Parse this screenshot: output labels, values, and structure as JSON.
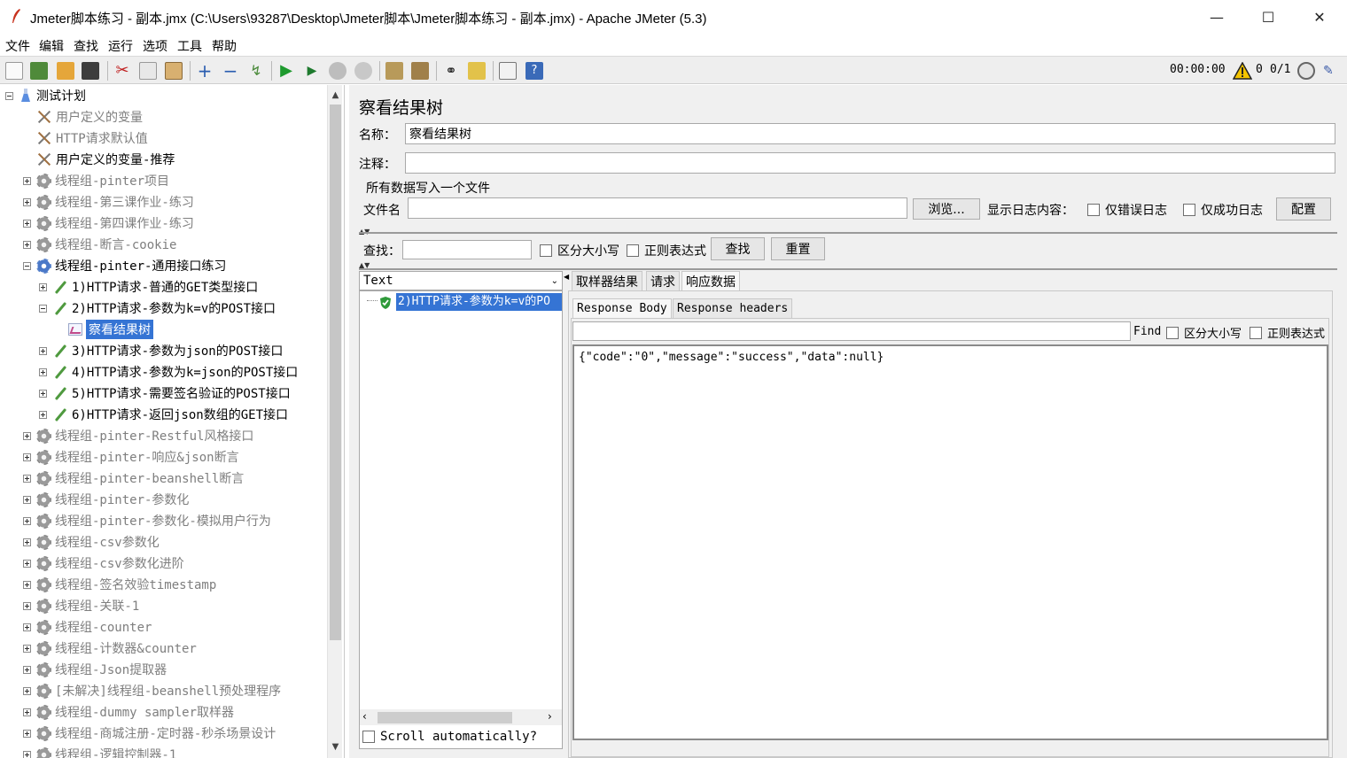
{
  "window": {
    "title": "Jmeter脚本练习 - 副本.jmx (C:\\Users\\93287\\Desktop\\Jmeter脚本\\Jmeter脚本练习 - 副本.jmx) - Apache JMeter (5.3)",
    "minimize": "—",
    "maximize": "☐",
    "close": "✕"
  },
  "menu": [
    "文件",
    "编辑",
    "查找",
    "运行",
    "选项",
    "工具",
    "帮助"
  ],
  "toolbar": {
    "timer": "00:00:00",
    "warnings": "0",
    "threads": "0/1",
    "icons": [
      "new-icon",
      "templates-icon",
      "open-icon",
      "save-icon",
      "cut-icon",
      "copy-icon",
      "paste-icon",
      "expand-icon",
      "collapse-icon",
      "toggle-icon",
      "start-icon",
      "start-no-pause-icon",
      "stop-icon",
      "shutdown-icon",
      "clear-icon",
      "clear-all-icon",
      "search-icon",
      "reset-search-icon",
      "function-helper-icon",
      "help-icon"
    ]
  },
  "tree": {
    "root": "测试计划",
    "nodes": [
      {
        "label": "用户定义的变量",
        "icon": "tools-icon",
        "level": 1,
        "expander": "",
        "dim": true
      },
      {
        "label": "HTTP请求默认值",
        "icon": "tools-icon",
        "level": 1,
        "expander": "",
        "dim": true
      },
      {
        "label": "用户定义的变量-推荐",
        "icon": "tools-icon",
        "level": 1,
        "expander": "",
        "dim": false
      },
      {
        "label": "线程组-pinter项目",
        "icon": "gear-icon",
        "level": 1,
        "expander": "plus",
        "dim": true
      },
      {
        "label": "线程组-第三课作业-练习",
        "icon": "gear-icon",
        "level": 1,
        "expander": "plus",
        "dim": true
      },
      {
        "label": "线程组-第四课作业-练习",
        "icon": "gear-icon",
        "level": 1,
        "expander": "plus",
        "dim": true
      },
      {
        "label": "线程组-断言-cookie",
        "icon": "gear-icon",
        "level": 1,
        "expander": "plus",
        "dim": true
      },
      {
        "label": "线程组-pinter-通用接口练习",
        "icon": "gear-icon-active",
        "level": 1,
        "expander": "minus",
        "dim": false
      },
      {
        "label": "1)HTTP请求-普通的GET类型接口",
        "icon": "pipette-icon",
        "level": 2,
        "expander": "plus",
        "dim": false
      },
      {
        "label": "2)HTTP请求-参数为k=v的POST接口",
        "icon": "pipette-icon",
        "level": 2,
        "expander": "minus",
        "dim": false
      },
      {
        "label": "察看结果树",
        "icon": "chart-icon",
        "level": 3,
        "expander": "",
        "dim": false,
        "selected": true
      },
      {
        "label": "3)HTTP请求-参数为json的POST接口",
        "icon": "pipette-icon",
        "level": 2,
        "expander": "plus",
        "dim": false
      },
      {
        "label": "4)HTTP请求-参数为k=json的POST接口",
        "icon": "pipette-icon",
        "level": 2,
        "expander": "plus",
        "dim": false
      },
      {
        "label": "5)HTTP请求-需要签名验证的POST接口",
        "icon": "pipette-icon",
        "level": 2,
        "expander": "plus",
        "dim": false
      },
      {
        "label": "6)HTTP请求-返回json数组的GET接口",
        "icon": "pipette-icon",
        "level": 2,
        "expander": "plus",
        "dim": false
      },
      {
        "label": "线程组-pinter-Restful风格接口",
        "icon": "gear-icon",
        "level": 1,
        "expander": "plus",
        "dim": true
      },
      {
        "label": "线程组-pinter-响应&json断言",
        "icon": "gear-icon",
        "level": 1,
        "expander": "plus",
        "dim": true
      },
      {
        "label": "线程组-pinter-beanshell断言",
        "icon": "gear-icon",
        "level": 1,
        "expander": "plus",
        "dim": true
      },
      {
        "label": "线程组-pinter-参数化",
        "icon": "gear-icon",
        "level": 1,
        "expander": "plus",
        "dim": true
      },
      {
        "label": "线程组-pinter-参数化-模拟用户行为",
        "icon": "gear-icon",
        "level": 1,
        "expander": "plus",
        "dim": true
      },
      {
        "label": "线程组-csv参数化",
        "icon": "gear-icon",
        "level": 1,
        "expander": "plus",
        "dim": true
      },
      {
        "label": "线程组-csv参数化进阶",
        "icon": "gear-icon",
        "level": 1,
        "expander": "plus",
        "dim": true
      },
      {
        "label": "线程组-签名效验timestamp",
        "icon": "gear-icon",
        "level": 1,
        "expander": "plus",
        "dim": true
      },
      {
        "label": "线程组-关联-1",
        "icon": "gear-icon",
        "level": 1,
        "expander": "plus",
        "dim": true
      },
      {
        "label": "线程组-counter",
        "icon": "gear-icon",
        "level": 1,
        "expander": "plus",
        "dim": true
      },
      {
        "label": "线程组-计数器&counter",
        "icon": "gear-icon",
        "level": 1,
        "expander": "plus",
        "dim": true
      },
      {
        "label": "线程组-Json提取器",
        "icon": "gear-icon",
        "level": 1,
        "expander": "plus",
        "dim": true
      },
      {
        "label": "[未解决]线程组-beanshell预处理程序",
        "icon": "gear-icon",
        "level": 1,
        "expander": "plus",
        "dim": true
      },
      {
        "label": "线程组-dummy sampler取样器",
        "icon": "gear-icon",
        "level": 1,
        "expander": "plus",
        "dim": true
      },
      {
        "label": "线程组-商城注册-定时器-秒杀场景设计",
        "icon": "gear-icon",
        "level": 1,
        "expander": "plus",
        "dim": true
      },
      {
        "label": "线程组-逻辑控制器-1",
        "icon": "gear-icon",
        "level": 1,
        "expander": "plus",
        "dim": true
      }
    ]
  },
  "panel": {
    "title": "察看结果树",
    "name_label": "名称：",
    "name_value": "察看结果树",
    "comment_label": "注释：",
    "comment_value": "",
    "file_group_title": "所有数据写入一个文件",
    "filename_label": "文件名",
    "filename_value": "",
    "browse_button": "浏览...",
    "log_display_label": "显示日志内容：",
    "errors_only": "仅错误日志",
    "success_only": "仅成功日志",
    "config_button": "配置",
    "search_label": "查找：",
    "search_value": "",
    "case_sensitive": "区分大小写",
    "regex": "正则表达式",
    "search_button": "查找",
    "reset_button": "重置",
    "renderer": "Text",
    "result_item": "2)HTTP请求-参数为k=v的PO",
    "scroll_auto": "Scroll automatically?",
    "tabs": [
      "取样器结果",
      "请求",
      "响应数据"
    ],
    "subtabs": [
      "Response Body",
      "Response headers"
    ],
    "find_label": "Find",
    "find_value": "",
    "find_case": "区分大小写",
    "find_regex": "正则表达式",
    "response_body": "{\"code\":\"0\",\"message\":\"success\",\"data\":null}"
  }
}
